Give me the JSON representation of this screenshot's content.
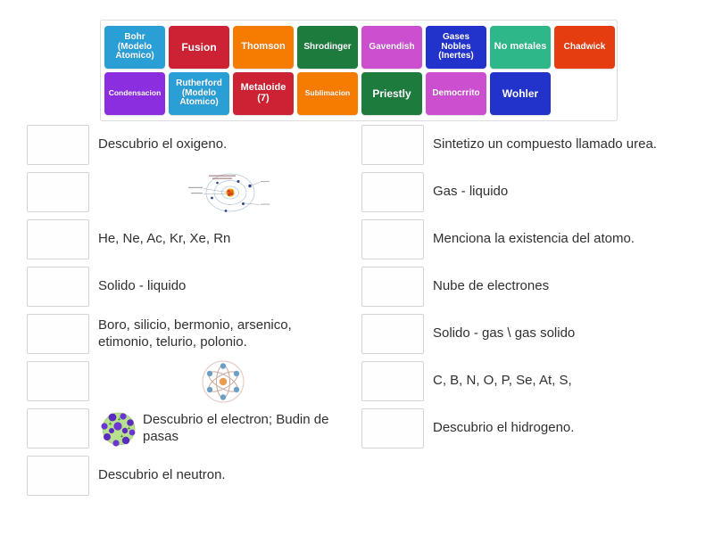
{
  "tile_bank": {
    "rows": [
      [
        {
          "label": "Bohr (Modelo Atomico)",
          "color": "#2a9fd6",
          "size": "fs-10"
        },
        {
          "label": "Fusion",
          "color": "#cc2233",
          "size": "fs-12"
        },
        {
          "label": "Thomson",
          "color": "#f57c00",
          "size": "fs-11"
        },
        {
          "label": "Shrodinger",
          "color": "#1e7b3e",
          "size": "fs-10"
        },
        {
          "label": "Gavendish",
          "color": "#cc4fd0",
          "size": "fs-10"
        },
        {
          "label": "Gases Nobles (Inertes)",
          "color": "#2233cc",
          "size": "fs-10"
        },
        {
          "label": "No metales",
          "color": "#2eb88a",
          "size": "fs-11"
        },
        {
          "label": "Chadwick",
          "color": "#e53d10",
          "size": "fs-10"
        }
      ],
      [
        {
          "label": "Condensacion",
          "color": "#8b2ee0",
          "size": "fs-9"
        },
        {
          "label": "Rutherford (Modelo Atomico)",
          "color": "#2a9fd6",
          "size": "fs-10"
        },
        {
          "label": "Metaloide (7)",
          "color": "#cc2233",
          "size": "fs-11"
        },
        {
          "label": "Sublimacion",
          "color": "#f57c00",
          "size": "fs-9"
        },
        {
          "label": "Priestly",
          "color": "#1e7b3e",
          "size": "fs-12"
        },
        {
          "label": "Democrrito",
          "color": "#cc4fd0",
          "size": "fs-10"
        },
        {
          "label": "Wohler",
          "color": "#2233cc",
          "size": "fs-12"
        }
      ]
    ]
  },
  "left_column": [
    {
      "text": "Descubrio el oxigeno.",
      "media": "none"
    },
    {
      "text": "",
      "media": "bohr-diagram"
    },
    {
      "text": "He, Ne, Ac, Kr, Xe, Rn",
      "media": "none"
    },
    {
      "text": "Solido - liquido",
      "media": "none"
    },
    {
      "text": "Boro, silicio, bermonio, arsenico, etimonio, telurio, polonio.",
      "media": "none"
    },
    {
      "text": "",
      "media": "atom-icon"
    },
    {
      "text": "Descubrio el electron; Budin de pasas",
      "media": "plum-pudding-icon"
    },
    {
      "text": "Descubrio el neutron.",
      "media": "none"
    }
  ],
  "right_column": [
    {
      "text": "Sintetizo un compuesto llamado urea.",
      "media": "none"
    },
    {
      "text": "Gas - liquido",
      "media": "none"
    },
    {
      "text": "Menciona la existencia del atomo.",
      "media": "none"
    },
    {
      "text": "Nube de electrones",
      "media": "none"
    },
    {
      "text": "Solido - gas \\ gas solido",
      "media": "none"
    },
    {
      "text": "C, B, N, O, P, Se, At, S,",
      "media": "none"
    },
    {
      "text": "Descubrio el hidrogeno.",
      "media": "none"
    }
  ],
  "colors": {
    "page_background": "#ffffff",
    "drop_zone_border": "#d4d4d4",
    "text": "#303030",
    "bank_border": "#dcdcdc"
  }
}
